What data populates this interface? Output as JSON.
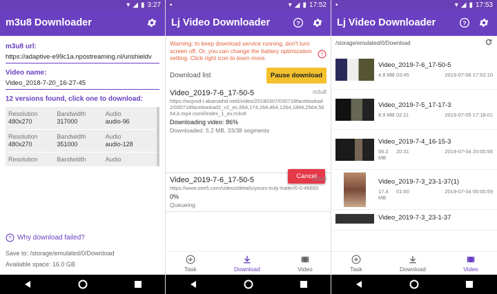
{
  "screen1": {
    "status_time": "3:27",
    "title": "m3u8 Downloader",
    "url_label": "m3u8 url:",
    "url_value": "https://adaptive-e99c1a.npostreaming.nl/urishieldv",
    "video_name_label": "Video name:",
    "video_name_value": "Video_2018-7-20_16-27-45",
    "versions_label": "12 versions found, click one to download:",
    "versions": [
      {
        "resolution_label": "Resolution",
        "resolution": "480x270",
        "bandwidth_label": "Bandwidth",
        "bandwidth": "317000",
        "audio_label": "Audio",
        "audio": "audio-96"
      },
      {
        "resolution_label": "Resolution",
        "resolution": "480x270",
        "bandwidth_label": "Bandwidth",
        "bandwidth": "351000",
        "audio_label": "Audio",
        "audio": "audio-128"
      },
      {
        "resolution_label": "Resolution",
        "resolution": "",
        "bandwidth_label": "Bandwidth",
        "bandwidth": "",
        "audio_label": "Audio",
        "audio": ""
      }
    ],
    "help_text": "Why download failed?",
    "save_to": "Save to: /storage/emulated/0/Download",
    "space": "Available space: 16.0 GB"
  },
  "screen2": {
    "status_time": "17:52",
    "title": "Lj Video Downloader",
    "warning": "Warning: to keep download service running, don't turn screen off. Or, you can change the battery optimization setting. Click right icon to learn more.",
    "download_list_label": "Download list",
    "pause_label": "Pause download",
    "tasks": [
      {
        "name": "Video_2019-7-6_17-50-5",
        "format": "m3u8",
        "url": "https://wsjvod-i.akamaihd.net/i/video/20180307/030718facebookad2/030718facebookad2_v2_ec,664,174,264,464,1264,1864,2564,5064,k.mp4.csmil/index_1_av.m3u8",
        "status": "Downloading video: 86%",
        "sub": "Downloaded: 5.2 MB, 33/38 segments"
      },
      {
        "name": "Video_2019-7-6_17-50-5",
        "format": "m3u8",
        "url": "https://www.zee5.com/videos/details/yours-truly-trailer/0-0-45693",
        "status": "0%",
        "sub": "Queueing"
      }
    ],
    "cancel_label": "Cancel"
  },
  "screen3": {
    "status_time": "17:53",
    "title": "Lj Video Downloader",
    "path": "/storage/emulated/0/Download",
    "videos": [
      {
        "name": "Video_2019-7-6_17-50-5",
        "size": "4.8 MB",
        "duration": "03:45",
        "date": "2019-07-06 17:52:10"
      },
      {
        "name": "Video_2019-7-5_17-17-3",
        "size": "8.9 MB",
        "duration": "02:11",
        "date": "2019-07-05 17:18:01"
      },
      {
        "name": "Video_2019-7-4_16-15-3",
        "size": "56.2 MB",
        "duration": "20:31",
        "date": "2019-07-04 20:00:56"
      },
      {
        "name": "Video_2019-7-3_23-1-37(1)",
        "size": "17.4 MB",
        "duration": "01:00",
        "date": "2019-07-04 00:00:59"
      },
      {
        "name": "Video_2019-7-3_23-1-37",
        "size": "",
        "duration": "",
        "date": ""
      }
    ]
  },
  "bottom_nav": {
    "task": "Task",
    "download": "Download",
    "video": "Video"
  },
  "colors": {
    "primary": "#6a3fc0",
    "accent": "#f3c12e",
    "cancel": "#e5394a",
    "warning": "#e0603a"
  }
}
